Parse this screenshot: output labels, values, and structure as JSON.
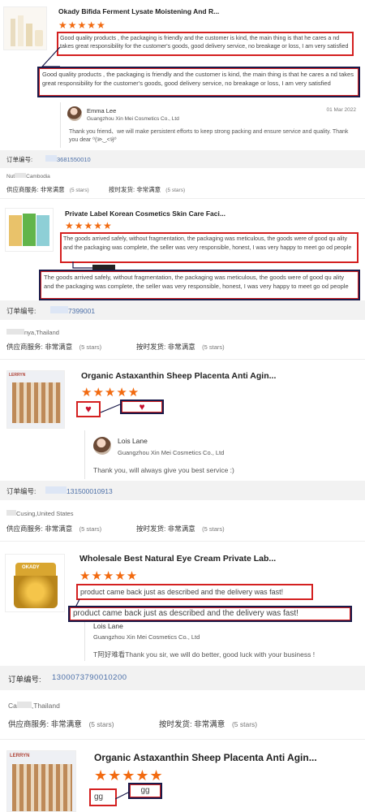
{
  "reviews": [
    {
      "product_title": "Okady Bifida Ferment Lysate Moistening And R...",
      "stars": "★★★★★",
      "comment": "Good quality products , the packaging is friendly and the customer is kind, the main thing is that he cares a nd takes great responsibility for the customer's goods, good delivery service, no breakage or loss, I am very satisfied",
      "comment_highlight": "Good quality products , the packaging is friendly and the customer is kind, the main thing is that he cares a nd takes great responsibility for the customer's goods, good delivery service, no breakage or loss, I am very satisfied",
      "reply": {
        "name": "Emma Lee",
        "company": "Guangzhou Xin Mei Cosmetics Co., Ltd",
        "date": "01 Mar 2022",
        "text": "Thank you friend、we will make persistent efforts to keep strong packing and ensure service and quality. Thank you dear ⁰(ᵒ̷>‿<ᵒ̷)⁰"
      },
      "order_label": "订单编号:",
      "order_no": "3681550010",
      "location": "Cambodia",
      "location_prefix": "Nut",
      "supplier_label": "供应商服务:",
      "supplier_value": "非常满意",
      "supplier_stars": "(5 stars)",
      "ship_label": "按时发货:",
      "ship_value": "非常满意",
      "ship_stars": "(5 stars)"
    },
    {
      "product_title": "Private Label Korean Cosmetics Skin Care Faci...",
      "stars": "★★★★★",
      "comment": "The goods arrived safely, without fragmentation, the packaging was meticulous, the goods were of good qu ality and the packaging was complete, the seller was very responsible, honest, I was very happy to meet go od people",
      "comment_highlight": "The goods arrived safely, without fragmentation, the packaging was meticulous, the goods were of good qu ality and the packaging was complete, the seller was very responsible, honest, I was very happy to meet go od people",
      "order_label": "订单编号:",
      "order_no": "7399001",
      "location": "nya,Thailand",
      "supplier_label": "供应商服务:",
      "supplier_value": "非常满意",
      "supplier_stars": "(5 stars)",
      "ship_label": "按时发货:",
      "ship_value": "非常满意",
      "ship_stars": "(5 stars)"
    },
    {
      "product_title": "Organic Astaxanthin Sheep Placenta Anti Agin...",
      "stars": "★★★★★",
      "comment": "♥",
      "comment_highlight": "♥",
      "reply": {
        "name": "Lois Lane",
        "company": "Guangzhou Xin Mei Cosmetics Co., Ltd",
        "text": "Thank you, will always give you best service :)"
      },
      "order_label": "订单编号:",
      "order_no": "131500010913",
      "location": "Cusing,United States",
      "supplier_label": "供应商服务:",
      "supplier_value": "非常满意",
      "supplier_stars": "(5 stars)",
      "ship_label": "按时发货:",
      "ship_value": "非常满意",
      "ship_stars": "(5 stars)"
    },
    {
      "product_title": "Wholesale Best Natural Eye Cream Private Lab...",
      "stars": "★★★★★",
      "comment": "product came back just as described and the delivery was fast!",
      "comment_highlight": "product came back just as described and the delivery was fast!",
      "reply": {
        "name": "Lois Lane",
        "company": "Guangzhou Xin Mei Cosmetics Co., Ltd",
        "text": "T阿好难看Thank you sir, we will do better, good luck with your business !"
      },
      "order_label": "订单编号:",
      "order_no": "1300073790010200",
      "location": ",Thailand",
      "location_prefix": "Ca",
      "supplier_label": "供应商服务:",
      "supplier_value": "非常满意",
      "supplier_stars": "(5 stars)",
      "ship_label": "按时发货:",
      "ship_value": "非常满意",
      "ship_stars": "(5 stars)"
    },
    {
      "product_title": "Organic Astaxanthin Sheep Placenta Anti Agin...",
      "stars": "★★★★★",
      "comment": "gg",
      "comment_highlight": "gg"
    }
  ]
}
